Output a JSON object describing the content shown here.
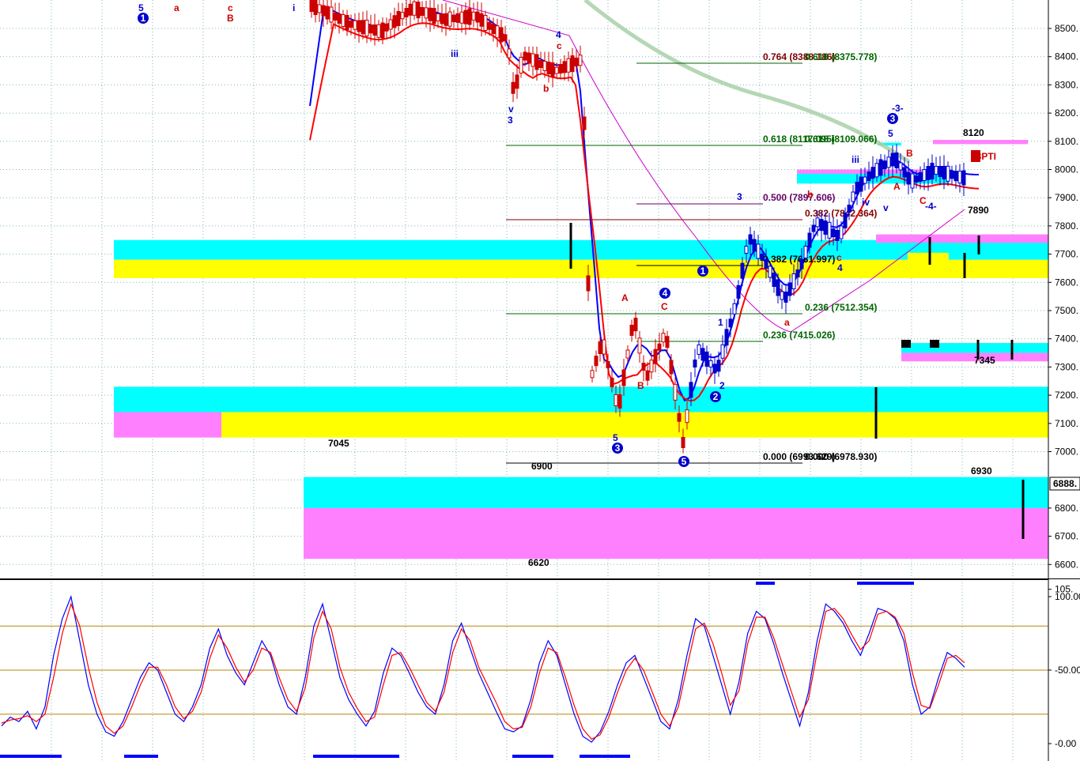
{
  "colors": {
    "background": "#ffffff",
    "grid": "#7fb8b8",
    "cyan_zone": "#00ffff",
    "yellow_zone": "#ffff00",
    "pink_zone": "#ff80ff",
    "ma_blue": "#0000ff",
    "ma_red": "#ff0000",
    "ma_darkred": "#c00000",
    "long_ma": "#a8d0a8",
    "magenta_line": "#cc00cc",
    "fib_green": "#006600",
    "fib_red": "#800000",
    "fib_purple": "#660066",
    "wave_blue": "#0000cc",
    "wave_red": "#cc0000"
  },
  "chart_data": [
    {
      "type": "candlestick",
      "ylim": [
        6575,
        8600
      ],
      "y_ticks": [
        "8500.",
        "8400.",
        "8300.",
        "8200.",
        "8100.",
        "8000.",
        "7900.",
        "7800.",
        "7700.",
        "7600.",
        "7500.",
        "7400.",
        "7300.",
        "7200.",
        "7100.",
        "7000.",
        "6800.",
        "6700.",
        "6600."
      ],
      "last_price_label": "6888.",
      "zones": [
        {
          "color": "cyan",
          "from": 7680,
          "to": 7750
        },
        {
          "color": "yellow",
          "from": 7615,
          "to": 7680
        },
        {
          "color": "cyan",
          "from": 7140,
          "to": 7230
        },
        {
          "color": "yellow",
          "from": 7050,
          "to": 7140
        },
        {
          "color": "pink",
          "from": 7050,
          "to": 7140
        },
        {
          "color": "cyan",
          "from": 6800,
          "to": 6910
        },
        {
          "color": "pink",
          "from": 6620,
          "to": 6800
        },
        {
          "color": "pink",
          "from": 7965,
          "to": 8000
        },
        {
          "color": "cyan",
          "from": 7950,
          "to": 7985
        },
        {
          "color": "pink",
          "from": 7740,
          "to": 7770
        },
        {
          "color": "cyan",
          "from": 7705,
          "to": 7740
        },
        {
          "color": "yellow",
          "from": 7615,
          "to": 7705
        },
        {
          "color": "cyan",
          "from": 7350,
          "to": 7385
        },
        {
          "color": "pink",
          "from": 7320,
          "to": 7350
        },
        {
          "color": "pink",
          "from": 8090,
          "to": 8105
        },
        {
          "color": "cyan",
          "from": 8085,
          "to": 8095
        }
      ],
      "level_labels": [
        "7045",
        "6900",
        "6620",
        "6930",
        "7345",
        "7890",
        "8120",
        "88PTI"
      ],
      "fib_labels": [
        {
          "text": "0.764 (8388.186)",
          "color": "darkred"
        },
        {
          "text": "0.618 (8375.778)",
          "color": "green"
        },
        {
          "text": "0.618 (8117.095)",
          "color": "green"
        },
        {
          "text": "0.618 (8109.066)",
          "color": "green"
        },
        {
          "text": "0.500 (7897.606)",
          "color": "purple"
        },
        {
          "text": "0.382 (7842.364)",
          "color": "darkred"
        },
        {
          "text": "0.382 (7681.997)",
          "color": "black"
        },
        {
          "text": "0.236 (7512.354)",
          "color": "green"
        },
        {
          "text": "0.236 (7415.026)",
          "color": "green"
        },
        {
          "text": "0.000 (6993.629)",
          "color": "black"
        },
        {
          "text": "0.000 (6978.930)",
          "color": "black"
        }
      ],
      "wave_labels": [
        {
          "text": "5",
          "color": "blue"
        },
        {
          "text": "1",
          "color": "blue",
          "circled": true
        },
        {
          "text": "a",
          "color": "red"
        },
        {
          "text": "c",
          "color": "red"
        },
        {
          "text": "B",
          "color": "red"
        },
        {
          "text": "i",
          "color": "blue"
        },
        {
          "text": "iii",
          "color": "blue"
        },
        {
          "text": "v",
          "color": "blue"
        },
        {
          "text": "3",
          "color": "blue"
        },
        {
          "text": "4",
          "color": "blue"
        },
        {
          "text": "c",
          "color": "red"
        },
        {
          "text": "b",
          "color": "red"
        },
        {
          "text": "5",
          "color": "blue"
        },
        {
          "text": "3",
          "color": "blue",
          "circled": true
        },
        {
          "text": "A",
          "color": "red"
        },
        {
          "text": "B",
          "color": "red"
        },
        {
          "text": "C",
          "color": "red"
        },
        {
          "text": "4",
          "color": "blue",
          "circled": true
        },
        {
          "text": "5",
          "color": "blue",
          "circled": true
        },
        {
          "text": "1",
          "color": "blue",
          "circled": true
        },
        {
          "text": "1",
          "color": "blue"
        },
        {
          "text": "2",
          "color": "blue"
        },
        {
          "text": "2",
          "color": "blue",
          "circled": true
        },
        {
          "text": "3",
          "color": "blue"
        },
        {
          "text": "a",
          "color": "red"
        },
        {
          "text": "b",
          "color": "red"
        },
        {
          "text": "c",
          "color": "red"
        },
        {
          "text": "4",
          "color": "blue"
        },
        {
          "text": "iii",
          "color": "blue"
        },
        {
          "text": "iv",
          "color": "blue"
        },
        {
          "text": "v",
          "color": "blue"
        },
        {
          "text": "-3-",
          "color": "blue"
        },
        {
          "text": "5",
          "color": "blue"
        },
        {
          "text": "3",
          "color": "blue",
          "circled": true
        },
        {
          "text": "B",
          "color": "red"
        },
        {
          "text": "A",
          "color": "red"
        },
        {
          "text": "C",
          "color": "red"
        },
        {
          "text": "-4-",
          "color": "blue"
        }
      ]
    },
    {
      "type": "line",
      "ylim": [
        -5,
        107
      ],
      "y_ticks": [
        "105.",
        "100.00",
        "-50.00",
        "-0.00"
      ],
      "reference_lines": [
        80,
        50,
        20
      ],
      "series": [
        {
          "color": "blue",
          "values": [
            12,
            18,
            15,
            22,
            10,
            25,
            60,
            85,
            100,
            70,
            40,
            20,
            8,
            5,
            15,
            30,
            45,
            55,
            50,
            35,
            20,
            15,
            25,
            40,
            65,
            78,
            60,
            48,
            40,
            55,
            70,
            60,
            40,
            25,
            20,
            45,
            80,
            95,
            70,
            45,
            30,
            20,
            12,
            22,
            48,
            65,
            60,
            48,
            35,
            25,
            20,
            40,
            70,
            82,
            65,
            48,
            35,
            22,
            10,
            8,
            12,
            30,
            55,
            70,
            60,
            40,
            20,
            5,
            1,
            8,
            22,
            40,
            55,
            60,
            45,
            30,
            15,
            10,
            30,
            60,
            85,
            80,
            60,
            40,
            20,
            42,
            75,
            90,
            85,
            68,
            48,
            30,
            12,
            35,
            70,
            95,
            90,
            82,
            70,
            60,
            75,
            92,
            90,
            85,
            70,
            40,
            20,
            25,
            45,
            62,
            58,
            52
          ]
        },
        {
          "color": "red",
          "values": [
            14,
            16,
            17,
            19,
            15,
            20,
            45,
            75,
            95,
            80,
            52,
            28,
            12,
            7,
            12,
            25,
            40,
            52,
            52,
            40,
            25,
            17,
            22,
            35,
            58,
            74,
            65,
            52,
            42,
            50,
            65,
            62,
            45,
            30,
            22,
            38,
            72,
            90,
            78,
            52,
            35,
            24,
            15,
            18,
            40,
            60,
            62,
            52,
            40,
            28,
            22,
            35,
            62,
            78,
            70,
            52,
            40,
            28,
            15,
            10,
            11,
            25,
            48,
            65,
            62,
            45,
            26,
            10,
            3,
            6,
            18,
            35,
            50,
            58,
            50,
            35,
            20,
            12,
            25,
            52,
            78,
            82,
            68,
            48,
            26,
            36,
            68,
            86,
            86,
            72,
            54,
            36,
            18,
            30,
            62,
            90,
            92,
            85,
            74,
            64,
            70,
            88,
            90,
            86,
            75,
            48,
            26,
            24,
            40,
            58,
            60,
            55
          ]
        }
      ]
    }
  ]
}
